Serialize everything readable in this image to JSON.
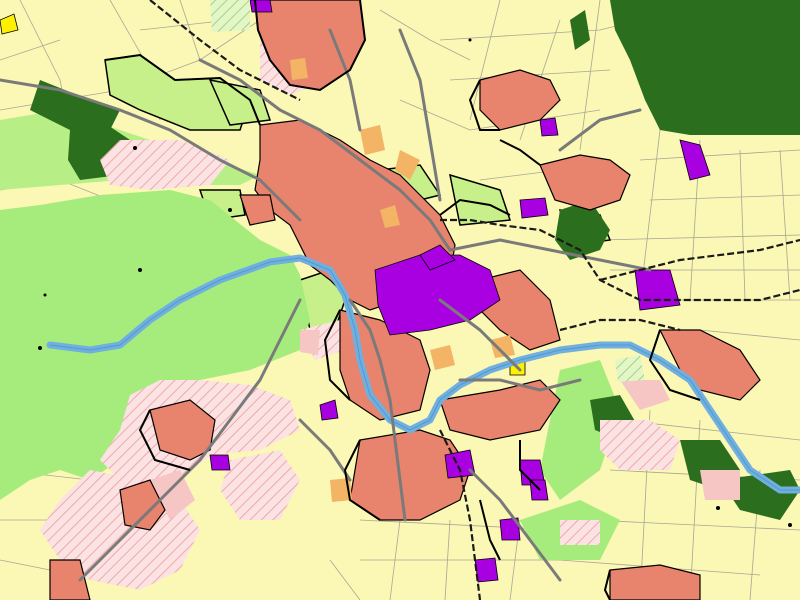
{
  "map": {
    "kind": "land-use zoning plan",
    "palette": {
      "agricultural": "#fbf7b4",
      "meadow": "#c8f08a",
      "park": "#a6ec7c",
      "forest": "#2b6e1e",
      "urban_mixed": "#e8836e",
      "urban_dense": "#d9725d",
      "residential_light": "#f5c6c4",
      "planned_development": "#f9dede",
      "industrial": "#a800e0",
      "civic": "#f3b466",
      "water": "#6fb0e0",
      "road": "#7a7a7a",
      "railway": "#1a1a1a",
      "boundary": "#000000",
      "special": "#ffef00"
    },
    "layers": [
      "agricultural-base",
      "meadow",
      "park",
      "forest",
      "planned-development",
      "urban",
      "industrial",
      "civic",
      "river",
      "roads",
      "railways",
      "boundaries"
    ]
  }
}
